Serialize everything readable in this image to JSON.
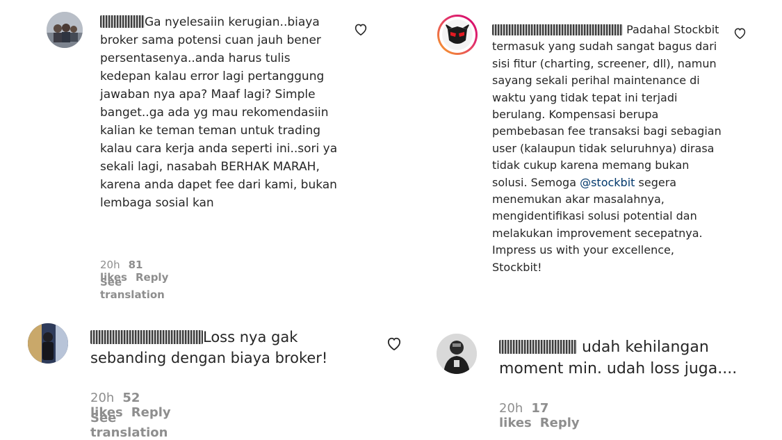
{
  "comments": [
    {
      "text": "Ga nyelesaiin kerugian..biaya broker sama potensi cuan jauh bener persentasenya..anda harus tulis kedepan kalau error lagi pertanggung jawaban nya apa? Maaf lagi? Simple banget..ga ada yg mau rekomendasiin kalian ke teman teman untuk trading kalau cara kerja anda seperti ini..sori ya sekali lagi, nasabah BERHAK MARAH, karena anda dapet fee dari kami, bukan lembaga sosial kan",
      "time": "20h",
      "likes": "81 likes",
      "reply": "Reply",
      "translate": "See translation"
    },
    {
      "text_before": "Padahal Stockbit termasuk yang sudah sangat bagus dari sisi fitur (charting, screener, dll), namun sayang sekali perihal maintenance di waktu yang tidak tepat ini terjadi berulang. Kompensasi berupa pembebasan fee transaksi bagi sebagian user (kalaupun tidak seluruhnya) dirasa tidak cukup karena memang bukan solusi. Semoga",
      "mention": "@stockbit",
      "text_after": "segera menemukan akar masalahnya, mengidentifikasi solusi potential dan melakukan improvement secepatnya. Impress us with your excellence, Stockbit!"
    },
    {
      "text": "Loss nya gak sebanding dengan biaya broker!",
      "time": "20h",
      "likes": "52 likes",
      "reply": "Reply",
      "translate": "See translation"
    },
    {
      "text": "udah kehilangan moment min. udah loss juga....",
      "time": "20h",
      "likes": "17 likes",
      "reply": "Reply"
    }
  ],
  "icons": {
    "like": "heart-outline-icon"
  },
  "colors": {
    "text": "#262626",
    "meta": "#8e8e8e",
    "mention": "#00376b",
    "story_ring_start": "#f9a825",
    "story_ring_end": "#d3006b"
  }
}
